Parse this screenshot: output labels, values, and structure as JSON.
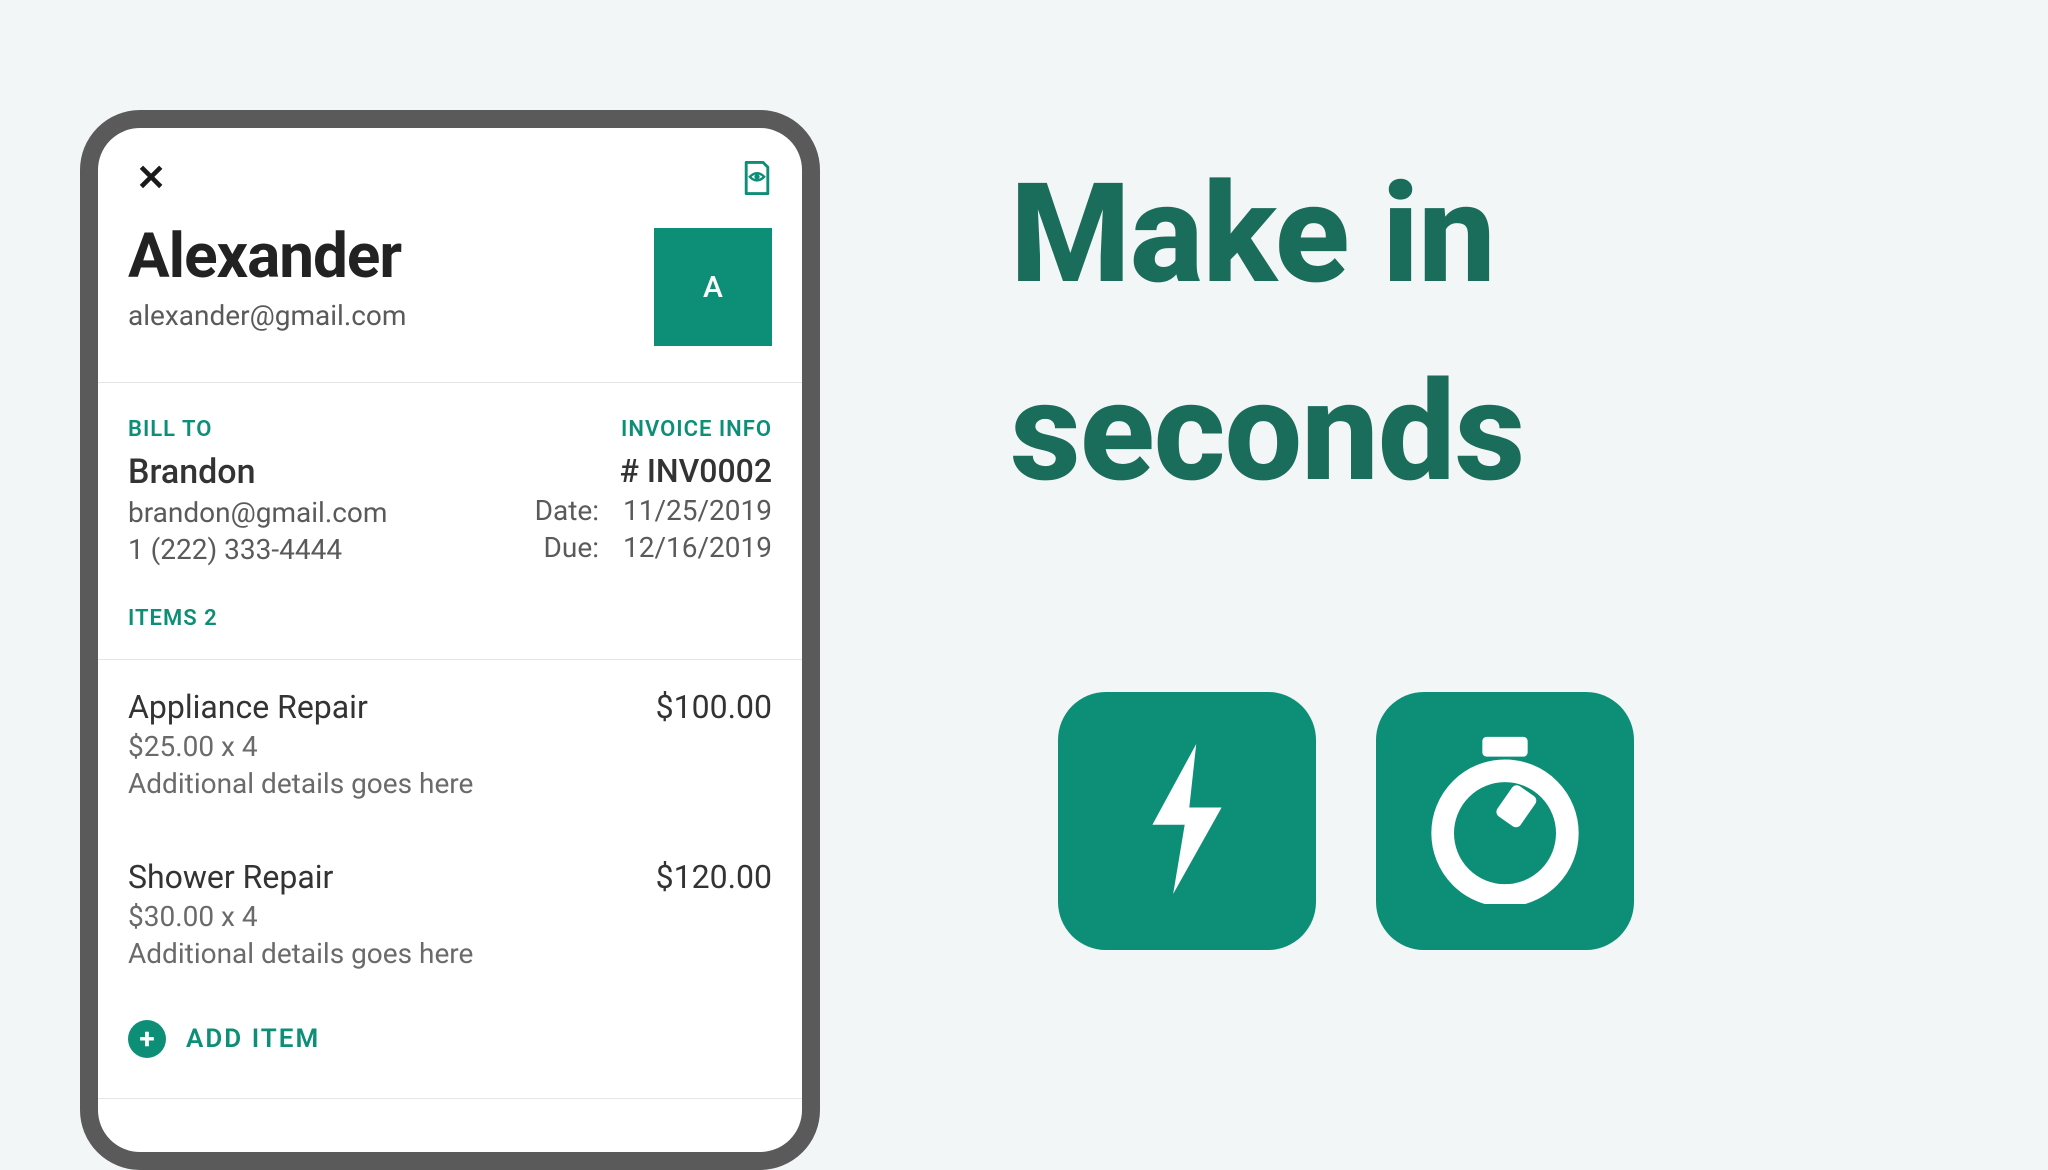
{
  "header": {
    "name": "Alexander",
    "email": "alexander@gmail.com",
    "avatar_initial": "A"
  },
  "bill_to": {
    "label": "BILL TO",
    "name": "Brandon",
    "email": "brandon@gmail.com",
    "phone": "1 (222) 333-4444"
  },
  "invoice": {
    "label": "INVOICE INFO",
    "number": "# INV0002",
    "date_label": "Date:",
    "date_value": "11/25/2019",
    "due_label": "Due:",
    "due_value": "12/16/2019"
  },
  "items_header": "ITEMS 2",
  "items": [
    {
      "title": "Appliance Repair",
      "calc": "$25.00 x 4",
      "details": "Additional details goes here",
      "amount": "$100.00"
    },
    {
      "title": "Shower Repair",
      "calc": "$30.00 x 4",
      "details": "Additional details goes here",
      "amount": "$120.00"
    }
  ],
  "add_item_label": "ADD ITEM",
  "promo": {
    "line1": "Make in",
    "line2": "seconds"
  },
  "colors": {
    "brand": "#0d8f77",
    "brand_dark": "#1a6c5b"
  }
}
